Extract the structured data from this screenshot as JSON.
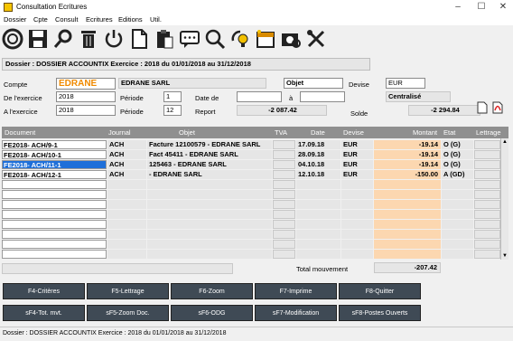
{
  "window": {
    "title": "Consultation Ecritures",
    "min": "–",
    "max": "☐",
    "close": "✕"
  },
  "menu": [
    "Dossier",
    "Cpte",
    "Consult",
    "Ecritures",
    "Editions",
    "Util."
  ],
  "toolbar_icons": [
    "lifebuoy-icon",
    "save-icon",
    "search-icon",
    "trash-icon",
    "power-icon",
    "document-icon",
    "clipboard-icon",
    "comment-icon",
    "magnifier-icon",
    "refresh-lightbulb-icon",
    "calendar-icon",
    "camera-search-icon",
    "tools-icon"
  ],
  "dossier_bar": "Dossier : DOSSIER ACCOUNTIX   Exercice : 2018 du 01/01/2018 au 31/12/2018",
  "form": {
    "compte_label": "Compte",
    "compte_value": "EDRANE",
    "compte_name": "EDRANE SARL",
    "objet_label": "Objet",
    "devise_label": "Devise",
    "devise_value": "EUR",
    "de_exercice_label": "De l'exercice",
    "de_exercice_value": "2018",
    "periode_label": "Période",
    "periode_from": "1",
    "date_de_label": "Date de",
    "a_label": "à",
    "centralise": "Centralisé",
    "a_exercice_label": "A  l'exercice",
    "a_exercice_value": "2018",
    "periode_label2": "Période",
    "periode_to": "12",
    "report_label": "Report",
    "report_value": "-2 087.42",
    "solde_label": "Solde",
    "solde_value": "-2 294.84"
  },
  "grid": {
    "headers": [
      "Document",
      "Journal",
      "Objet",
      "TVA",
      "Date",
      "Devise",
      "Montant",
      "Etat",
      "Lettrage"
    ],
    "rows": [
      {
        "doc": "FE2018- ACH/9-1",
        "journal": "ACH",
        "objet": "Facture 12100579 - EDRANE SARL",
        "tva": "",
        "date": "17.09.18",
        "devise": "EUR",
        "montant": "-19.14",
        "etat": "O (G)",
        "lettrage": ""
      },
      {
        "doc": "FE2018- ACH/10-1",
        "journal": "ACH",
        "objet": "Fact 45411 - EDRANE SARL",
        "tva": "",
        "date": "28.09.18",
        "devise": "EUR",
        "montant": "-19.14",
        "etat": "O (G)",
        "lettrage": ""
      },
      {
        "doc": "FE2018- ACH/11-1",
        "journal": "ACH",
        "objet": "125463 - EDRANE SARL",
        "tva": "",
        "date": "04.10.18",
        "devise": "EUR",
        "montant": "-19.14",
        "etat": "O (G)",
        "lettrage": ""
      },
      {
        "doc": "FE2018- ACH/12-1",
        "journal": "ACH",
        "objet": " - EDRANE SARL",
        "tva": "",
        "date": "12.10.18",
        "devise": "EUR",
        "montant": "-150.00",
        "etat": "A (GD)",
        "lettrage": ""
      }
    ],
    "total_label": "Total mouvement",
    "total_value": "-207.42"
  },
  "buttons_row1": [
    "F4-Critères",
    "F5-Lettrage",
    "F6-Zoom",
    "F7-Imprime",
    "F8-Quitter"
  ],
  "buttons_row2": [
    "sF4-Tot. mvt.",
    "sF5-Zoom Doc.",
    "sF6-ODG",
    "sF7-Modification",
    "sF8-Postes Ouverts"
  ],
  "status": "Dossier : DOSSIER ACCOUNTIX   Exercice : 2018 du 01/01/2018 au 31/12/2018"
}
